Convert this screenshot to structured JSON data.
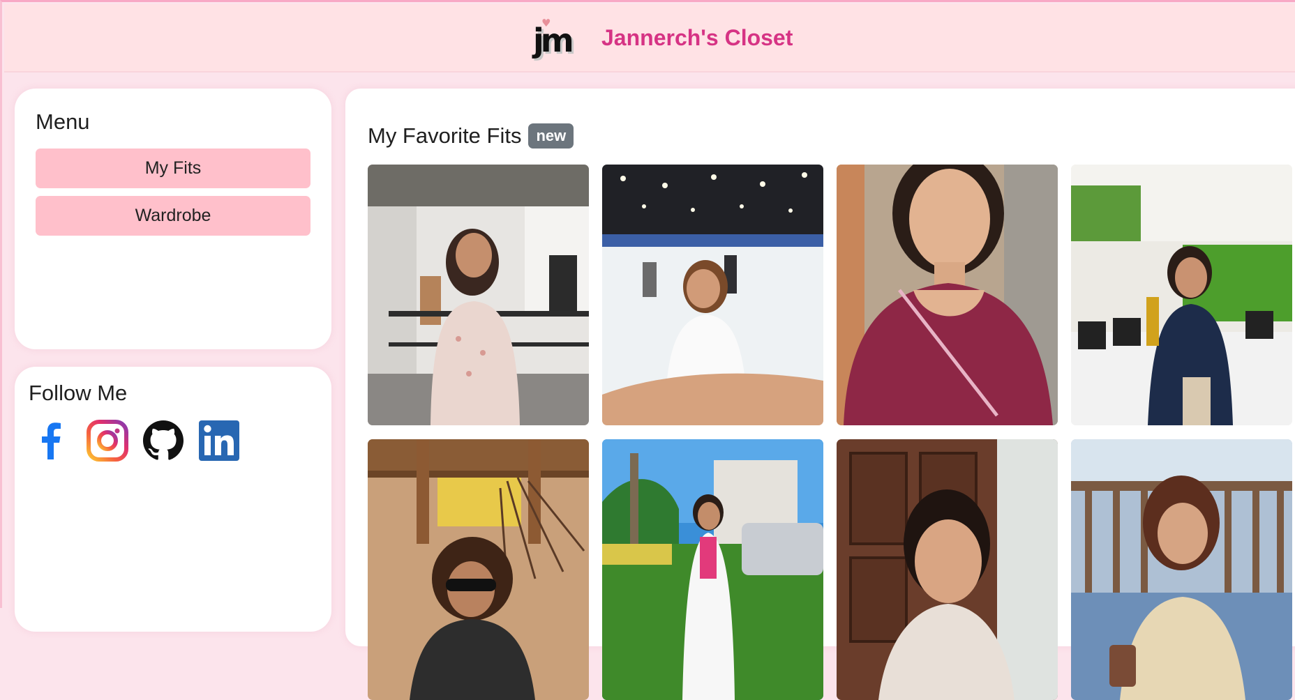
{
  "header": {
    "logo_text": "jm",
    "site_title": "Jannerch's Closet"
  },
  "menu": {
    "title": "Menu",
    "items": [
      {
        "label": "My Fits"
      },
      {
        "label": "Wardrobe"
      }
    ]
  },
  "follow": {
    "title": "Follow Me",
    "links": [
      {
        "icon": "facebook-icon"
      },
      {
        "icon": "instagram-icon"
      },
      {
        "icon": "github-icon"
      },
      {
        "icon": "linkedin-icon"
      }
    ]
  },
  "main": {
    "title": "My Favorite Fits",
    "badge": "new"
  },
  "colors": {
    "accent": "#d63384",
    "page_bg": "#fce4ec",
    "header_bg": "#ffe2e5",
    "button_bg": "#ffc0cb",
    "badge_bg": "#6c757d"
  }
}
